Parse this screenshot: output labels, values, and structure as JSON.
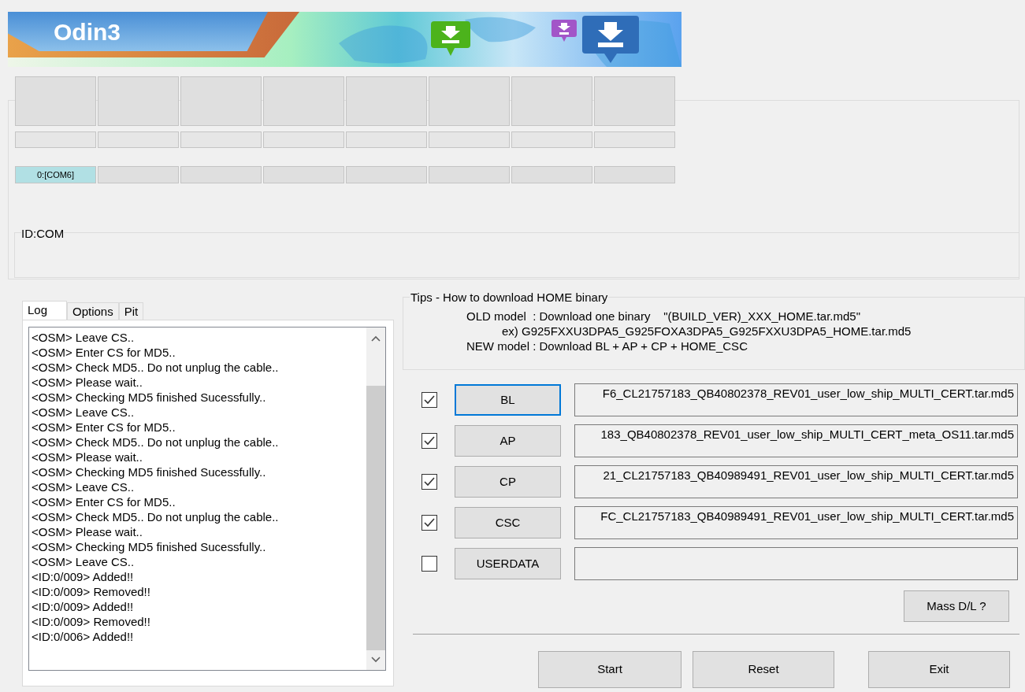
{
  "banner": {
    "logo": "Odin3"
  },
  "ports": [
    {
      "label": "0:[COM6]",
      "connected": true
    },
    {
      "connected": false
    },
    {
      "connected": false
    },
    {
      "connected": false
    },
    {
      "connected": false
    },
    {
      "connected": false
    },
    {
      "connected": false
    },
    {
      "connected": false
    }
  ],
  "id_com": {
    "title": "ID:COM"
  },
  "tabs": [
    {
      "label": "Log",
      "selected": true
    },
    {
      "label": "Options",
      "selected": false
    },
    {
      "label": "Pit",
      "selected": false
    }
  ],
  "log": [
    "<OSM> Leave CS..",
    "<OSM> Enter CS for MD5..",
    "<OSM> Check MD5.. Do not unplug the cable..",
    "<OSM> Please wait..",
    "<OSM> Checking MD5 finished Sucessfully..",
    "<OSM> Leave CS..",
    "<OSM> Enter CS for MD5..",
    "<OSM> Check MD5.. Do not unplug the cable..",
    "<OSM> Please wait..",
    "<OSM> Checking MD5 finished Sucessfully..",
    "<OSM> Leave CS..",
    "<OSM> Enter CS for MD5..",
    "<OSM> Check MD5.. Do not unplug the cable..",
    "<OSM> Please wait..",
    "<OSM> Checking MD5 finished Sucessfully..",
    "<OSM> Leave CS..",
    "<ID:0/009> Added!!",
    "<ID:0/009> Removed!!",
    "<ID:0/009> Added!!",
    "<ID:0/009> Removed!!",
    "<ID:0/006> Added!!"
  ],
  "tips": {
    "title": "Tips - How to download HOME binary",
    "lines": [
      {
        "kind": "main",
        "text": "OLD model  : Download one binary    \"(BUILD_VER)_XXX_HOME.tar.md5\""
      },
      {
        "kind": "sub",
        "text": "ex) G925FXXU3DPA5_G925FOXA3DPA5_G925FXXU3DPA5_HOME.tar.md5"
      },
      {
        "kind": "main",
        "text": "NEW model : Download BL + AP + CP + HOME_CSC"
      }
    ]
  },
  "files": [
    {
      "button": "BL",
      "checked": true,
      "focused": true,
      "value": "F6_CL21757183_QB40802378_REV01_user_low_ship_MULTI_CERT.tar.md5"
    },
    {
      "button": "AP",
      "checked": true,
      "focused": false,
      "value": "183_QB40802378_REV01_user_low_ship_MULTI_CERT_meta_OS11.tar.md5"
    },
    {
      "button": "CP",
      "checked": true,
      "focused": false,
      "value": "21_CL21757183_QB40989491_REV01_user_low_ship_MULTI_CERT.tar.md5"
    },
    {
      "button": "CSC",
      "checked": true,
      "focused": false,
      "value": "FC_CL21757183_QB40989491_REV01_user_low_ship_MULTI_CERT.tar.md5"
    },
    {
      "button": "USERDATA",
      "checked": false,
      "focused": false
    }
  ],
  "mass_dl": "Mass D/L ?",
  "actions": [
    "Start",
    "Reset",
    "Exit"
  ]
}
